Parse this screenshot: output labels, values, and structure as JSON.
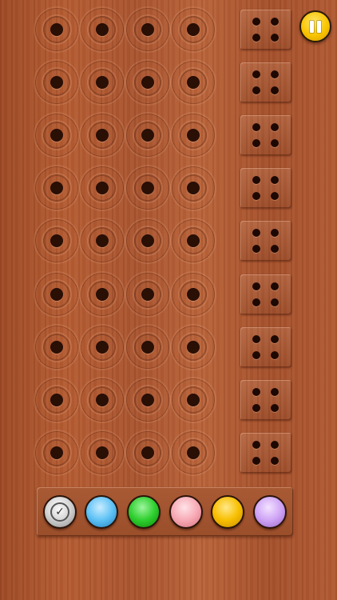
{
  "game": {
    "rows": 9,
    "holes_per_row": 4,
    "feedback_pegs_per_row": 4
  },
  "controls": {
    "pause_icon": "pause-icon",
    "check_icon": "checkmark-icon",
    "check_glyph": "✓"
  },
  "palette": {
    "colors": [
      {
        "name": "blue",
        "hex_light": "#c9ecff",
        "hex": "#5fc2f5",
        "hex_dark": "#1f7fc0"
      },
      {
        "name": "green",
        "hex_light": "#9ef59e",
        "hex": "#2fcf2f",
        "hex_dark": "#0a8a0a"
      },
      {
        "name": "pink",
        "hex_light": "#ffe3e8",
        "hex": "#f7aab5",
        "hex_dark": "#d4707e"
      },
      {
        "name": "yellow",
        "hex_light": "#ffe88a",
        "hex": "#f8bf00",
        "hex_dark": "#c48a00"
      },
      {
        "name": "violet",
        "hex_light": "#f3e3ff",
        "hex": "#cfa4f6",
        "hex_dark": "#9a66c9"
      }
    ]
  }
}
